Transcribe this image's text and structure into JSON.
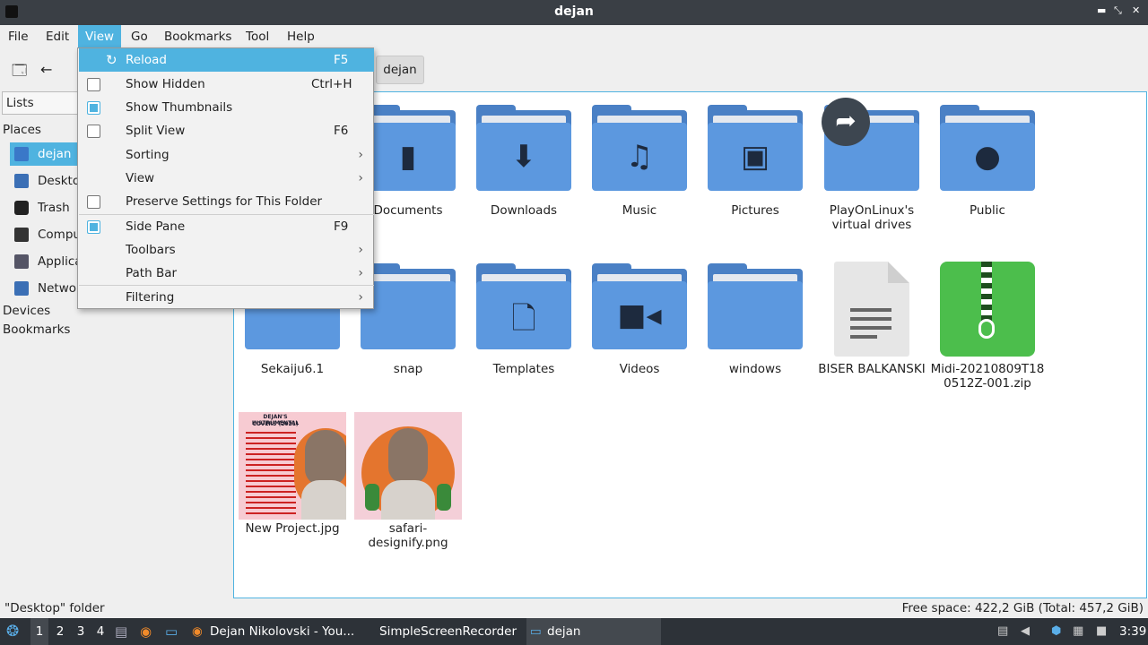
{
  "window": {
    "title": "dejan"
  },
  "menubar": {
    "items": [
      "File",
      "Edit",
      "View",
      "Go",
      "Bookmarks",
      "Tool",
      "Help"
    ]
  },
  "path_bar": {
    "current": "dejan"
  },
  "sidebar": {
    "mode": "Lists",
    "places_label": "Places",
    "places": [
      "dejan",
      "Desktop",
      "Trash",
      "Computer",
      "Applications",
      "Network"
    ],
    "devices_label": "Devices",
    "bookmarks_label": "Bookmarks"
  },
  "view_menu": {
    "reload": {
      "label": "Reload",
      "shortcut": "F5"
    },
    "show_hidden": {
      "label": "Show Hidden",
      "shortcut": "Ctrl+H",
      "checked": false
    },
    "show_thumbnails": {
      "label": "Show Thumbnails",
      "checked": true
    },
    "split_view": {
      "label": "Split View",
      "shortcut": "F6",
      "checked": false
    },
    "sorting": {
      "label": "Sorting"
    },
    "view": {
      "label": "View"
    },
    "preserve": {
      "label": "Preserve Settings for This Folder",
      "checked": false
    },
    "side_pane": {
      "label": "Side Pane",
      "shortcut": "F9",
      "checked": true
    },
    "toolbars": {
      "label": "Toolbars"
    },
    "path_bar": {
      "label": "Path Bar"
    },
    "filtering": {
      "label": "Filtering"
    }
  },
  "files": {
    "documents": "Documents",
    "downloads": "Downloads",
    "music": "Music",
    "pictures": "Pictures",
    "playonlinux": "PlayOnLinux's virtual drives",
    "public": "Public",
    "sekaiju": "Sekaiju6.1",
    "snap": "snap",
    "templates": "Templates",
    "videos": "Videos",
    "windows": "windows",
    "biser": "BISER BALKANSKI",
    "midi_line1": "Midi-20210809T18",
    "midi_line2": "0512Z-001.zip",
    "new_project": "New Project.jpg",
    "safari_line1": "safari-",
    "safari_line2": "designify.png"
  },
  "thumb_text": {
    "title": "DEJAN'S INSTRUMENTAL",
    "subtitle": "COVERS (2021)"
  },
  "status": {
    "left": "\"Desktop\" folder",
    "right": "Free space: 422,2 GiB (Total: 457,2 GiB)"
  },
  "taskbar": {
    "workspaces": [
      "1",
      "2",
      "3",
      "4"
    ],
    "tasks": [
      "Dejan Nikolovski - You...",
      "SimpleScreenRecorder",
      "dejan"
    ],
    "clock": "3:39"
  },
  "colors": {
    "accent": "#4fb3e0",
    "folder": "#5c98df",
    "zip": "#4cbe4c",
    "titlebar": "#3a3f45"
  }
}
